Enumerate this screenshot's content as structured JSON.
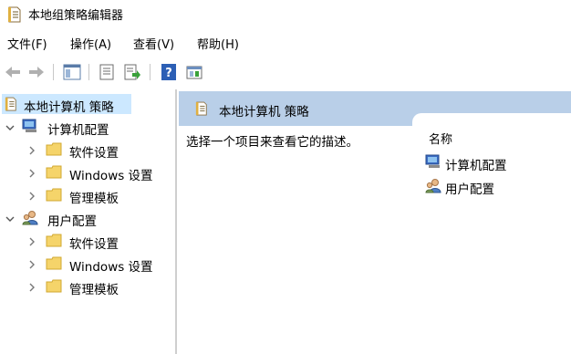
{
  "window": {
    "title": "本地组策略编辑器",
    "icon": "policy-document-icon"
  },
  "menu": [
    "文件(F)",
    "操作(A)",
    "查看(V)",
    "帮助(H)"
  ],
  "toolbar": {
    "icons": [
      "back-arrow-icon",
      "forward-arrow-icon",
      "show-hide-tree-icon",
      "properties-icon",
      "export-list-icon",
      "help-icon",
      "console-view-icon"
    ]
  },
  "tree": {
    "root": "本地计算机 策略",
    "computer_config": "计算机配置",
    "user_config": "用户配置",
    "computer_children": [
      "软件设置",
      "Windows 设置",
      "管理模板"
    ],
    "user_children": [
      "软件设置",
      "Windows 设置",
      "管理模板"
    ]
  },
  "details": {
    "header_title": "本地计算机 策略",
    "description": "选择一个项目来查看它的描述。",
    "column_name": "名称",
    "items": [
      "计算机配置",
      "用户配置"
    ]
  },
  "colors": {
    "selection": "#cce8ff",
    "header": "#b9cfe8",
    "folder": "#f5d46a"
  }
}
